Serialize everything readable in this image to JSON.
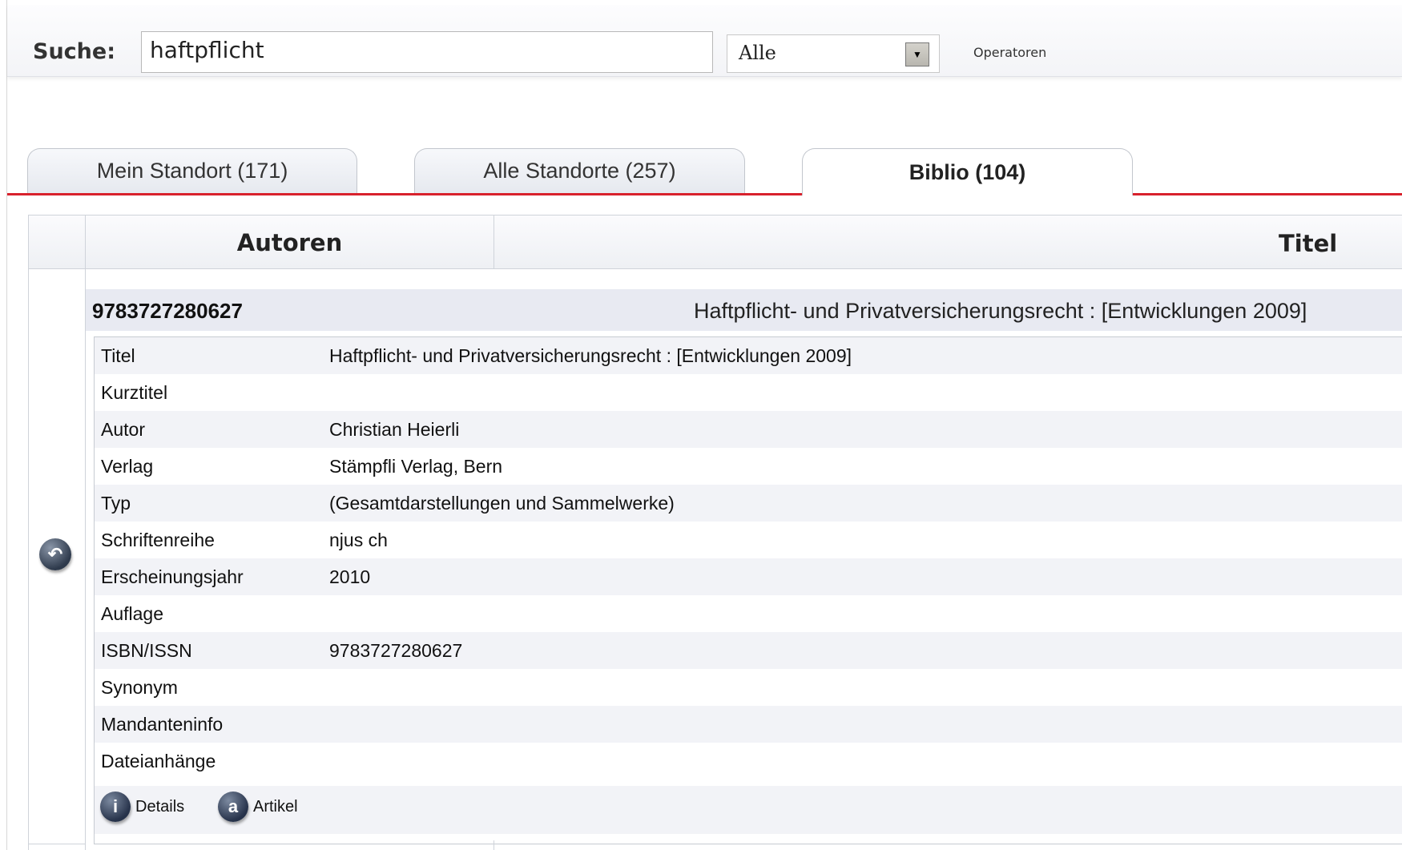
{
  "search": {
    "label": "Suche:",
    "query": "haftpflicht",
    "scope_value": "Alle",
    "operators_label": "Operatoren"
  },
  "tabs": [
    {
      "label": "Mein Standort (171)"
    },
    {
      "label": "Alle Standorte (257)"
    },
    {
      "label": "Biblio (104)",
      "active": true
    }
  ],
  "table": {
    "col_authors": "Autoren",
    "col_title": "Titel"
  },
  "record": {
    "id": "9783727280627",
    "title": "Haftpflicht- und Privatversicherungsrecht : [Entwicklungen 2009]",
    "fields": [
      {
        "label": "Titel",
        "value": "Haftpflicht- und Privatversicherungsrecht : [Entwicklungen 2009]"
      },
      {
        "label": "Kurztitel",
        "value": ""
      },
      {
        "label": "Autor",
        "value": "Christian Heierli"
      },
      {
        "label": "Verlag",
        "value": "Stämpfli Verlag, Bern"
      },
      {
        "label": "Typ",
        "value": "(Gesamtdarstellungen und Sammelwerke)"
      },
      {
        "label": "Schriftenreihe",
        "value": "njus ch"
      },
      {
        "label": "Erscheinungsjahr",
        "value": "2010"
      },
      {
        "label": "Auflage",
        "value": ""
      },
      {
        "label": "ISBN/ISSN",
        "value": "9783727280627"
      },
      {
        "label": "Synonym",
        "value": ""
      },
      {
        "label": "Mandanteninfo",
        "value": ""
      },
      {
        "label": "Dateianhänge",
        "value": ""
      }
    ],
    "actions": {
      "details_label": "Details",
      "details_icon": "info-icon",
      "article_label": "Artikel",
      "article_icon": "article-a-icon"
    }
  },
  "colors": {
    "accent": "#d8212c",
    "row_stripe": "#f2f3f7",
    "record_header": "#e8eaf2"
  }
}
